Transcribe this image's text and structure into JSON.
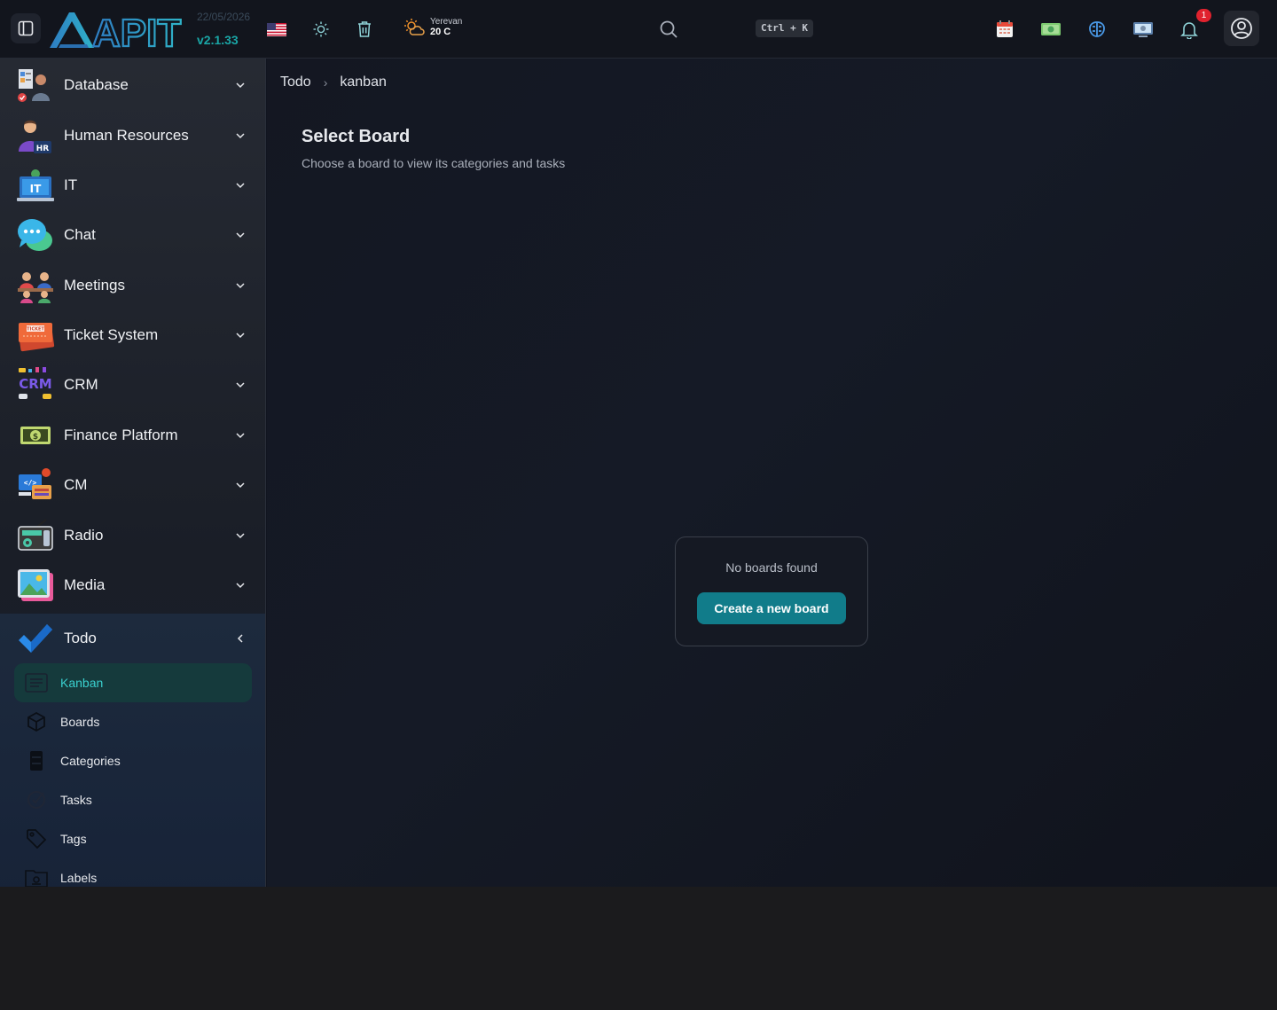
{
  "header": {
    "logo_text": "APIT",
    "date": "22/05/2026",
    "version": "v2.1.33",
    "weather": {
      "city": "Yerevan",
      "temp": "20 C"
    },
    "shortcut": "Ctrl + K",
    "notification_count": "1"
  },
  "sidebar": {
    "items": [
      {
        "label": "Database"
      },
      {
        "label": "Human Resources"
      },
      {
        "label": "IT"
      },
      {
        "label": "Chat"
      },
      {
        "label": "Meetings"
      },
      {
        "label": "Ticket System"
      },
      {
        "label": "CRM"
      },
      {
        "label": "Finance Platform"
      },
      {
        "label": "CM"
      },
      {
        "label": "Radio"
      },
      {
        "label": "Media"
      },
      {
        "label": "Todo"
      }
    ],
    "todo_sub": [
      {
        "label": "Kanban"
      },
      {
        "label": "Boards"
      },
      {
        "label": "Categories"
      },
      {
        "label": "Tasks"
      },
      {
        "label": "Tags"
      },
      {
        "label": "Labels"
      }
    ]
  },
  "breadcrumb": {
    "root": "Todo",
    "current": "kanban"
  },
  "main": {
    "title": "Select Board",
    "subtitle": "Choose a board to view its categories and tasks",
    "empty_text": "No boards found",
    "create_label": "Create a new board"
  },
  "colors": {
    "accent": "#117c8a",
    "active_text": "#3ad0cf",
    "badge": "#e0222e"
  }
}
